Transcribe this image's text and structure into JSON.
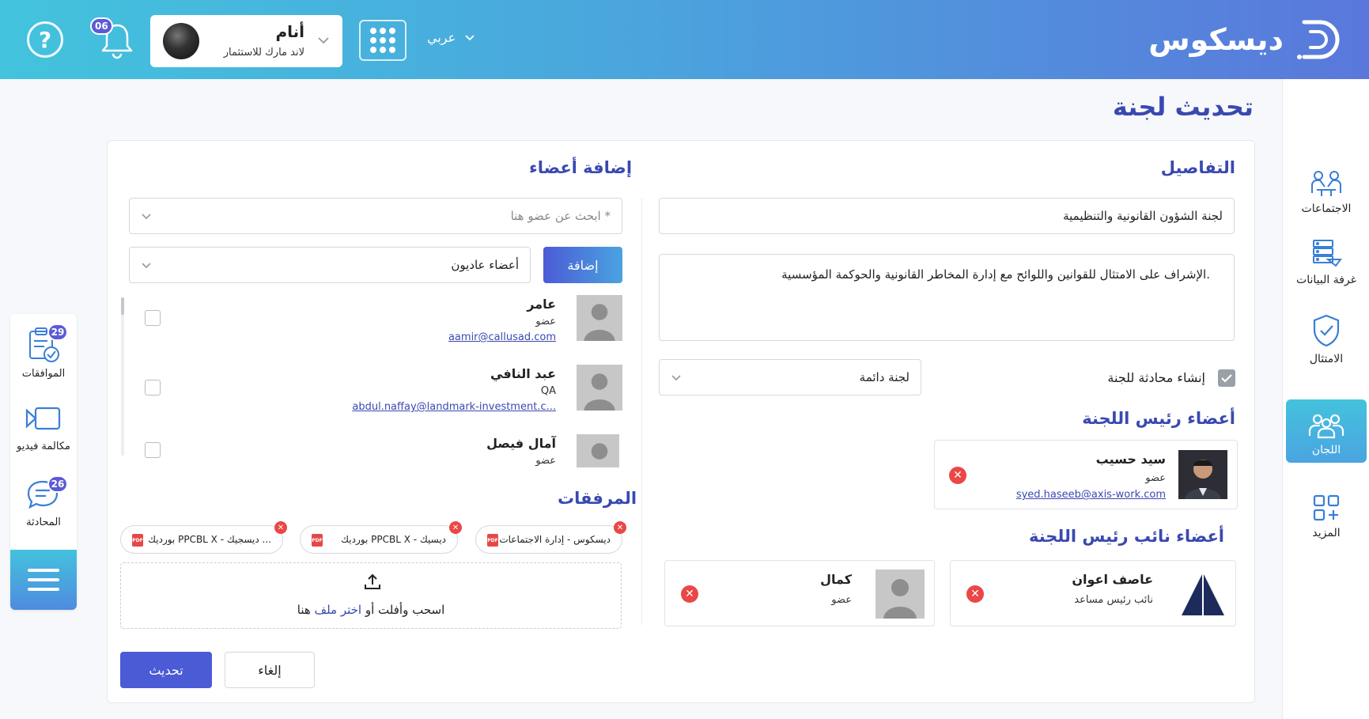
{
  "header": {
    "logo_text": "ديسكوس",
    "language": "عربي",
    "notifications_count": "06",
    "profile": {
      "name": "أنام",
      "organization": "لاند مارك للاستثمار"
    },
    "help_symbol": "?"
  },
  "right_sidebar": {
    "items": [
      {
        "label": "الاجتماعات",
        "icon": "meetings-icon"
      },
      {
        "label": "غرفة البيانات",
        "icon": "data-room-icon"
      },
      {
        "label": "الامتثال",
        "icon": "compliance-shield-icon"
      },
      {
        "label": "اللجان",
        "icon": "committees-icon",
        "active": true
      },
      {
        "label": "المزيد",
        "icon": "more-grid-icon"
      }
    ]
  },
  "left_sidebar": {
    "items": [
      {
        "label": "الموافقات",
        "badge": "29",
        "icon": "approvals-icon"
      },
      {
        "label": "مكالمة فيديو",
        "icon": "video-call-icon"
      },
      {
        "label": "المحادثة",
        "badge": "26",
        "icon": "chat-icon"
      }
    ],
    "menu_icon": "hamburger-menu-icon"
  },
  "page": {
    "title": "تحديث لجنة"
  },
  "details": {
    "title": "التفاصيل",
    "committee_name": "لجنة الشؤون القانونية والتنظيمية",
    "description": "الإشراف على الامتثال للقوانين واللوائح مع إدارة المخاطر القانونية والحوكمة المؤسسية.",
    "create_chat_label": "إنشاء محادثة للجنة",
    "create_chat_checked": true,
    "committee_type": "لجنة دائمة",
    "chair_section_title": "أعضاء رئيس اللجنة",
    "chair_members": [
      {
        "name": "سيد حسيب",
        "role": "عضو",
        "email": "syed.haseeb@axis-work.com"
      }
    ],
    "vice_chair_section_title": "أعضاء نائب رئيس اللجنة",
    "vice_chair_members": [
      {
        "name": "عاصف اعوان",
        "role": "نائب رئيس مساعد"
      },
      {
        "name": "كمال",
        "role": "عضو"
      }
    ]
  },
  "add_members": {
    "title": "إضافة أعضاء",
    "search_placeholder": "ابحث عن عضو هنا *",
    "member_type": "أعضاء عاديون",
    "add_button": "إضافة",
    "list": [
      {
        "name": "عامر",
        "role": "عضو",
        "email": "aamir@callusad.com"
      },
      {
        "name": "عبد النافي",
        "role": "QA",
        "email": "abdul.naffay@landmark-investment.c..."
      },
      {
        "name": "آمال فيصل",
        "role": "عضو"
      }
    ]
  },
  "attachments": {
    "title": "المرفقات",
    "files": [
      "ديسكوس - إدارة الاجتماعات",
      "بورديك PPCBL X - ديسيك",
      "بورديك PPCBL X - ديسجيك ..."
    ],
    "file_icon_text": "PDF",
    "dropzone_text": "اسحب وأفلت أو",
    "dropzone_link": "اختر ملف",
    "dropzone_suffix": "هنا"
  },
  "actions": {
    "update": "تحديث",
    "cancel": "إلغاء"
  },
  "colors": {
    "primary": "#3a49b0",
    "accent_start": "#43c3dd",
    "accent_end": "#5a78dc",
    "badge": "#5b5bd6",
    "danger": "#ea4747"
  }
}
